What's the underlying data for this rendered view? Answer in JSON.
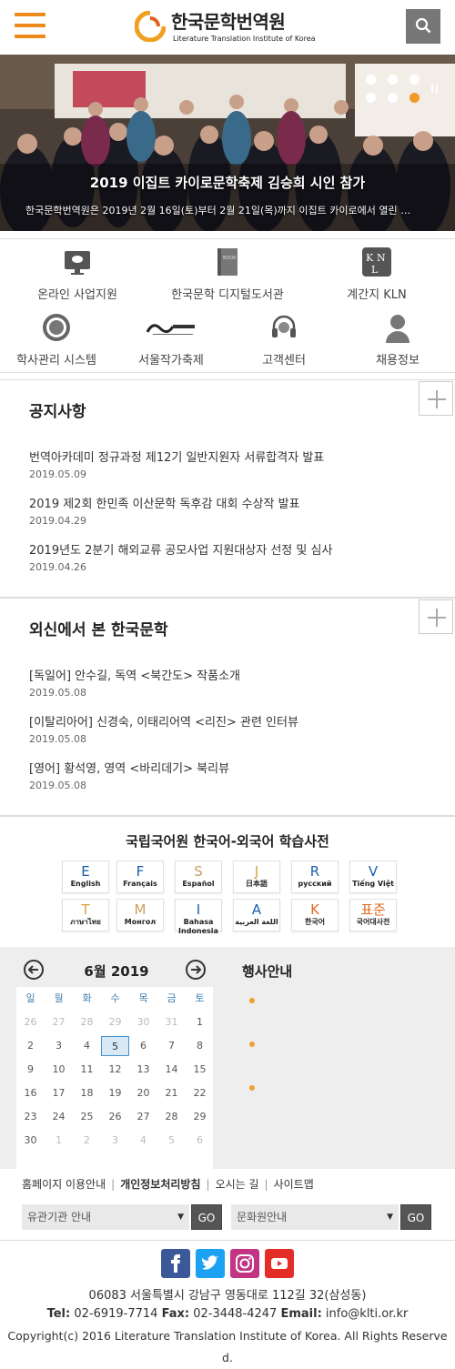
{
  "header": {
    "logo_kr": "한국문학번역원",
    "logo_en": "Literature Translation Institute of Korea"
  },
  "hero": {
    "title": "2019 이집트 카이로문학축제 김승희 시인 참가",
    "subtitle": "한국문학번역원은 2019년 2월 16일(토)부터 2월 21일(목)까지 이집트 카이로에서 열린 …"
  },
  "quick_links": [
    {
      "label": "온라인 사업지원",
      "icon": "monitor-chat-icon"
    },
    {
      "label": "한국문학 디지털도서관",
      "icon": "book-icon"
    },
    {
      "label": "계간지 KLN",
      "icon": "kln-magazine-icon"
    },
    {
      "label": "학사관리 시스템",
      "icon": "academy-seal-icon"
    },
    {
      "label": "서울작가축제",
      "icon": "seoul-festival-logo-icon"
    },
    {
      "label": "고객센터",
      "icon": "headset-icon"
    },
    {
      "label": "채용정보",
      "icon": "person-icon"
    }
  ],
  "notices": {
    "title": "공지사항",
    "items": [
      {
        "title": "번역아카데미 정규과정 제12기 일반지원자 서류합격자 발표",
        "date": "2019.05.09"
      },
      {
        "title": "2019 제2회 한민족 이산문학 독후감 대회 수상작 발표",
        "date": "2019.04.29"
      },
      {
        "title": "2019년도 2분기 해외교류 공모사업 지원대상자 선정 및 심사",
        "date": "2019.04.26"
      }
    ]
  },
  "foreign_press": {
    "title": "외신에서 본 한국문학",
    "items": [
      {
        "title": "[독일어] 안수길, 독역 <북간도> 작품소개",
        "date": "2019.05.08"
      },
      {
        "title": "[이탈리아어] 신경숙, 이태리어역 <리진> 관련 인터뷰",
        "date": "2019.05.08"
      },
      {
        "title": "[영어] 황석영, 영역 <바리데기> 북리뷰",
        "date": "2019.05.08"
      }
    ]
  },
  "dictionary": {
    "title": "국립국어원 한국어-외국어 학습사전",
    "langs": [
      {
        "letter": "E",
        "name": "English",
        "color": "#1a5fa8"
      },
      {
        "letter": "F",
        "name": "Français",
        "color": "#1a5fa8"
      },
      {
        "letter": "S",
        "name": "Español",
        "color": "#c8a060"
      },
      {
        "letter": "J",
        "name": "日本語",
        "color": "#d8a040"
      },
      {
        "letter": "R",
        "name": "русский",
        "color": "#1a5fa8"
      },
      {
        "letter": "V",
        "name": "Tiếng Việt",
        "color": "#1a5fa8"
      },
      {
        "letter": "T",
        "name": "ภาษาไทย",
        "color": "#d8a040"
      },
      {
        "letter": "M",
        "name": "Монгол",
        "color": "#c8a060"
      },
      {
        "letter": "I",
        "name": "Bahasa Indonesia",
        "color": "#1a5fa8"
      },
      {
        "letter": "A",
        "name": "اللغة العربية",
        "color": "#1a5fa8"
      },
      {
        "letter": "K",
        "name": "한국어",
        "color": "#e06a20"
      },
      {
        "letter": "표준",
        "name": "국어대사전",
        "color": "#e06a20"
      }
    ]
  },
  "calendar": {
    "title": "6월 2019",
    "weekdays": [
      "일",
      "월",
      "화",
      "수",
      "목",
      "금",
      "토"
    ],
    "weeks": [
      [
        "26",
        "27",
        "28",
        "29",
        "30",
        "31",
        "1"
      ],
      [
        "2",
        "3",
        "4",
        "5",
        "6",
        "7",
        "8"
      ],
      [
        "9",
        "10",
        "11",
        "12",
        "13",
        "14",
        "15"
      ],
      [
        "16",
        "17",
        "18",
        "19",
        "20",
        "21",
        "22"
      ],
      [
        "23",
        "24",
        "25",
        "26",
        "27",
        "28",
        "29"
      ],
      [
        "30",
        "1",
        "2",
        "3",
        "4",
        "5",
        "6"
      ]
    ],
    "today": "5",
    "events_title": "행사안내"
  },
  "footer": {
    "links": [
      "홈페이지 이용안내",
      "개인정보처리방침",
      "오시는 길",
      "사이트맵"
    ],
    "select1": "유관기관 안내",
    "select2": "문화원안내",
    "go": "GO",
    "address": "06083 서울특별시 강남구 영동대로 112길 32(삼성동)",
    "tel_label": "Tel:",
    "tel": "02-6919-7714",
    "fax_label": "Fax:",
    "fax": "02-3448-4247",
    "email_label": "Email:",
    "email": "info@klti.or.kr",
    "copyright_1": "Copyright(c) 2016 Literature Translation Institute of Korea. All Rights Reserve",
    "copyright_2": "d."
  }
}
